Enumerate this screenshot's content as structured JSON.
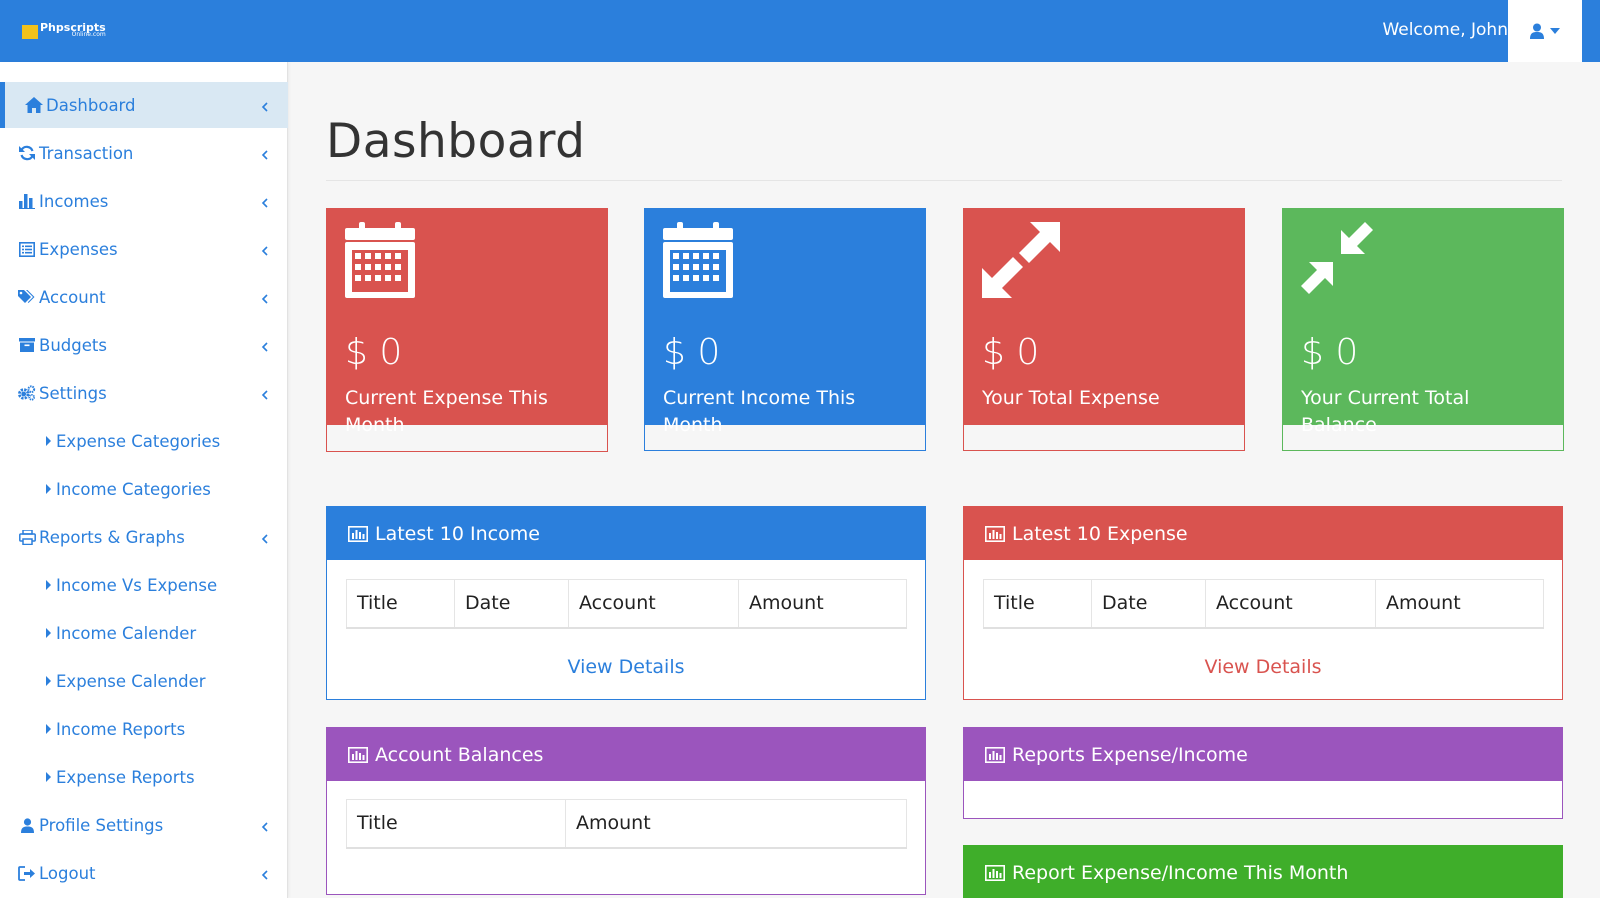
{
  "brand": {
    "name": "Phpscripts",
    "sub": "Online.com"
  },
  "header": {
    "welcome": "Welcome, John",
    "user_icon": "user-icon",
    "caret_icon": "caret-down-icon"
  },
  "sidebar": {
    "items": [
      {
        "label": "Dashboard",
        "icon": "home-icon",
        "active": true
      },
      {
        "label": "Transaction",
        "icon": "refresh-icon"
      },
      {
        "label": "Incomes",
        "icon": "bar-chart-icon"
      },
      {
        "label": "Expenses",
        "icon": "list-alt-icon"
      },
      {
        "label": "Account",
        "icon": "tags-icon"
      },
      {
        "label": "Budgets",
        "icon": "archive-icon"
      },
      {
        "label": "Settings",
        "icon": "cogs-icon"
      },
      {
        "label": "Expense Categories",
        "sub": true
      },
      {
        "label": "Income Categories",
        "sub": true
      },
      {
        "label": "Reports & Graphs",
        "icon": "print-icon"
      },
      {
        "label": "Income Vs Expense",
        "sub": true
      },
      {
        "label": "Income Calender",
        "sub": true
      },
      {
        "label": "Expense Calender",
        "sub": true
      },
      {
        "label": "Income Reports",
        "sub": true
      },
      {
        "label": "Expense Reports",
        "sub": true
      },
      {
        "label": "Profile Settings",
        "icon": "user-icon"
      },
      {
        "label": "Logout",
        "icon": "sign-out-icon"
      }
    ]
  },
  "main": {
    "title": "Dashboard",
    "stats": [
      {
        "amount": "$ 0",
        "label": "Current Expense This Month",
        "icon": "calendar-icon",
        "color": "#d9534f"
      },
      {
        "amount": "$ 0",
        "label": "Current Income This Month",
        "icon": "calendar-icon",
        "color": "#2b7fdc"
      },
      {
        "amount": "$ 0",
        "label": "Your Total Expense",
        "icon": "expand-icon",
        "color": "#d9534f"
      },
      {
        "amount": "$ 0",
        "label": "Your Current Total Balance",
        "icon": "compress-icon",
        "color": "#5cb85c"
      }
    ],
    "panels": {
      "income": {
        "title": "Latest 10 Income",
        "columns": [
          "Title",
          "Date",
          "Account",
          "Amount"
        ],
        "link": "View Details",
        "color": "#2b7fdc"
      },
      "expense": {
        "title": "Latest 10 Expense",
        "columns": [
          "Title",
          "Date",
          "Account",
          "Amount"
        ],
        "link": "View Details",
        "color": "#d9534f"
      },
      "balances": {
        "title": "Account Balances",
        "columns": [
          "Title",
          "Amount"
        ],
        "color": "#9b55bd"
      },
      "reports": {
        "title": "Reports Expense/Income",
        "color": "#9b55bd"
      },
      "month": {
        "title": "Report Expense/Income This Month",
        "color": "#3fae2a"
      }
    }
  }
}
